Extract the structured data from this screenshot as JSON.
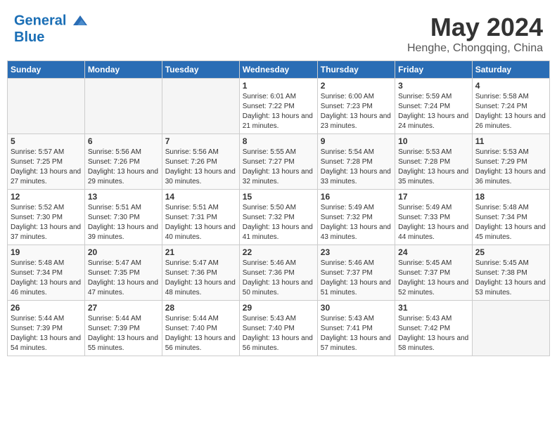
{
  "header": {
    "logo_line1": "General",
    "logo_line2": "Blue",
    "month_year": "May 2024",
    "location": "Henghe, Chongqing, China"
  },
  "weekdays": [
    "Sunday",
    "Monday",
    "Tuesday",
    "Wednesday",
    "Thursday",
    "Friday",
    "Saturday"
  ],
  "weeks": [
    [
      {
        "day": "",
        "info": ""
      },
      {
        "day": "",
        "info": ""
      },
      {
        "day": "",
        "info": ""
      },
      {
        "day": "1",
        "info": "Sunrise: 6:01 AM\nSunset: 7:22 PM\nDaylight: 13 hours and 21 minutes."
      },
      {
        "day": "2",
        "info": "Sunrise: 6:00 AM\nSunset: 7:23 PM\nDaylight: 13 hours and 23 minutes."
      },
      {
        "day": "3",
        "info": "Sunrise: 5:59 AM\nSunset: 7:24 PM\nDaylight: 13 hours and 24 minutes."
      },
      {
        "day": "4",
        "info": "Sunrise: 5:58 AM\nSunset: 7:24 PM\nDaylight: 13 hours and 26 minutes."
      }
    ],
    [
      {
        "day": "5",
        "info": "Sunrise: 5:57 AM\nSunset: 7:25 PM\nDaylight: 13 hours and 27 minutes."
      },
      {
        "day": "6",
        "info": "Sunrise: 5:56 AM\nSunset: 7:26 PM\nDaylight: 13 hours and 29 minutes."
      },
      {
        "day": "7",
        "info": "Sunrise: 5:56 AM\nSunset: 7:26 PM\nDaylight: 13 hours and 30 minutes."
      },
      {
        "day": "8",
        "info": "Sunrise: 5:55 AM\nSunset: 7:27 PM\nDaylight: 13 hours and 32 minutes."
      },
      {
        "day": "9",
        "info": "Sunrise: 5:54 AM\nSunset: 7:28 PM\nDaylight: 13 hours and 33 minutes."
      },
      {
        "day": "10",
        "info": "Sunrise: 5:53 AM\nSunset: 7:28 PM\nDaylight: 13 hours and 35 minutes."
      },
      {
        "day": "11",
        "info": "Sunrise: 5:53 AM\nSunset: 7:29 PM\nDaylight: 13 hours and 36 minutes."
      }
    ],
    [
      {
        "day": "12",
        "info": "Sunrise: 5:52 AM\nSunset: 7:30 PM\nDaylight: 13 hours and 37 minutes."
      },
      {
        "day": "13",
        "info": "Sunrise: 5:51 AM\nSunset: 7:30 PM\nDaylight: 13 hours and 39 minutes."
      },
      {
        "day": "14",
        "info": "Sunrise: 5:51 AM\nSunset: 7:31 PM\nDaylight: 13 hours and 40 minutes."
      },
      {
        "day": "15",
        "info": "Sunrise: 5:50 AM\nSunset: 7:32 PM\nDaylight: 13 hours and 41 minutes."
      },
      {
        "day": "16",
        "info": "Sunrise: 5:49 AM\nSunset: 7:32 PM\nDaylight: 13 hours and 43 minutes."
      },
      {
        "day": "17",
        "info": "Sunrise: 5:49 AM\nSunset: 7:33 PM\nDaylight: 13 hours and 44 minutes."
      },
      {
        "day": "18",
        "info": "Sunrise: 5:48 AM\nSunset: 7:34 PM\nDaylight: 13 hours and 45 minutes."
      }
    ],
    [
      {
        "day": "19",
        "info": "Sunrise: 5:48 AM\nSunset: 7:34 PM\nDaylight: 13 hours and 46 minutes."
      },
      {
        "day": "20",
        "info": "Sunrise: 5:47 AM\nSunset: 7:35 PM\nDaylight: 13 hours and 47 minutes."
      },
      {
        "day": "21",
        "info": "Sunrise: 5:47 AM\nSunset: 7:36 PM\nDaylight: 13 hours and 48 minutes."
      },
      {
        "day": "22",
        "info": "Sunrise: 5:46 AM\nSunset: 7:36 PM\nDaylight: 13 hours and 50 minutes."
      },
      {
        "day": "23",
        "info": "Sunrise: 5:46 AM\nSunset: 7:37 PM\nDaylight: 13 hours and 51 minutes."
      },
      {
        "day": "24",
        "info": "Sunrise: 5:45 AM\nSunset: 7:37 PM\nDaylight: 13 hours and 52 minutes."
      },
      {
        "day": "25",
        "info": "Sunrise: 5:45 AM\nSunset: 7:38 PM\nDaylight: 13 hours and 53 minutes."
      }
    ],
    [
      {
        "day": "26",
        "info": "Sunrise: 5:44 AM\nSunset: 7:39 PM\nDaylight: 13 hours and 54 minutes."
      },
      {
        "day": "27",
        "info": "Sunrise: 5:44 AM\nSunset: 7:39 PM\nDaylight: 13 hours and 55 minutes."
      },
      {
        "day": "28",
        "info": "Sunrise: 5:44 AM\nSunset: 7:40 PM\nDaylight: 13 hours and 56 minutes."
      },
      {
        "day": "29",
        "info": "Sunrise: 5:43 AM\nSunset: 7:40 PM\nDaylight: 13 hours and 56 minutes."
      },
      {
        "day": "30",
        "info": "Sunrise: 5:43 AM\nSunset: 7:41 PM\nDaylight: 13 hours and 57 minutes."
      },
      {
        "day": "31",
        "info": "Sunrise: 5:43 AM\nSunset: 7:42 PM\nDaylight: 13 hours and 58 minutes."
      },
      {
        "day": "",
        "info": ""
      }
    ]
  ]
}
